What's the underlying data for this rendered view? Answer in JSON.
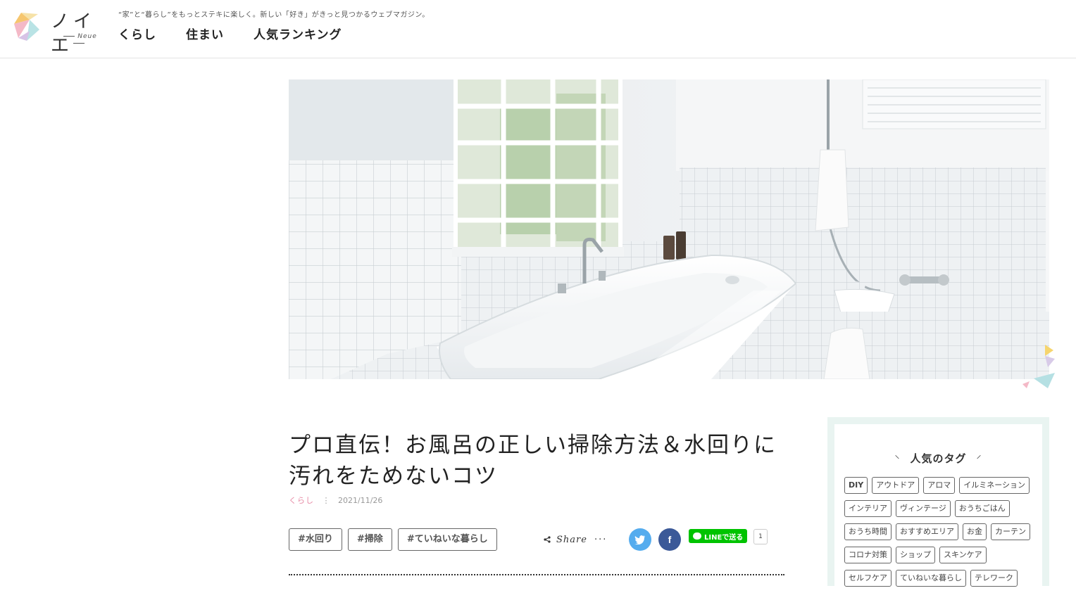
{
  "header": {
    "logo_text": "ノイエ",
    "logo_sub": "Neue",
    "tagline": "“家”と“暮らし”をもっとステキに楽しく。新しい「好き」がきっと見つかるウェブマガジン。",
    "nav": [
      "くらし",
      "住まい",
      "人気ランキング"
    ]
  },
  "article": {
    "title": "プロ直伝！お風呂の正しい掃除方法＆水回りに汚れをためないコツ",
    "category": "くらし",
    "date": "2021/11/26",
    "tags": [
      "#水回り",
      "#掃除",
      "#ていねいな暮らし"
    ],
    "share_label": "Share",
    "sns": {
      "twitter_icon": "twitter-icon",
      "facebook_icon": "facebook-icon",
      "line_label": "LINEで送る",
      "line_count": "1"
    }
  },
  "sidebar": {
    "title": "人気のタグ",
    "tags": [
      "DIY",
      "アウトドア",
      "アロマ",
      "イルミネーション",
      "インテリア",
      "ヴィンテージ",
      "おうちごはん",
      "おうち時間",
      "おすすめエリア",
      "お金",
      "カーテン",
      "コロナ対策",
      "ショップ",
      "スキンケア",
      "セルフケア",
      "ていねいな暮らし",
      "テレワーク"
    ]
  },
  "colors": {
    "accent_pink": "#e78aa5",
    "twitter": "#55acee",
    "facebook": "#3b5998",
    "line": "#00c300",
    "sidebar_bg": "#e9f4f1"
  }
}
